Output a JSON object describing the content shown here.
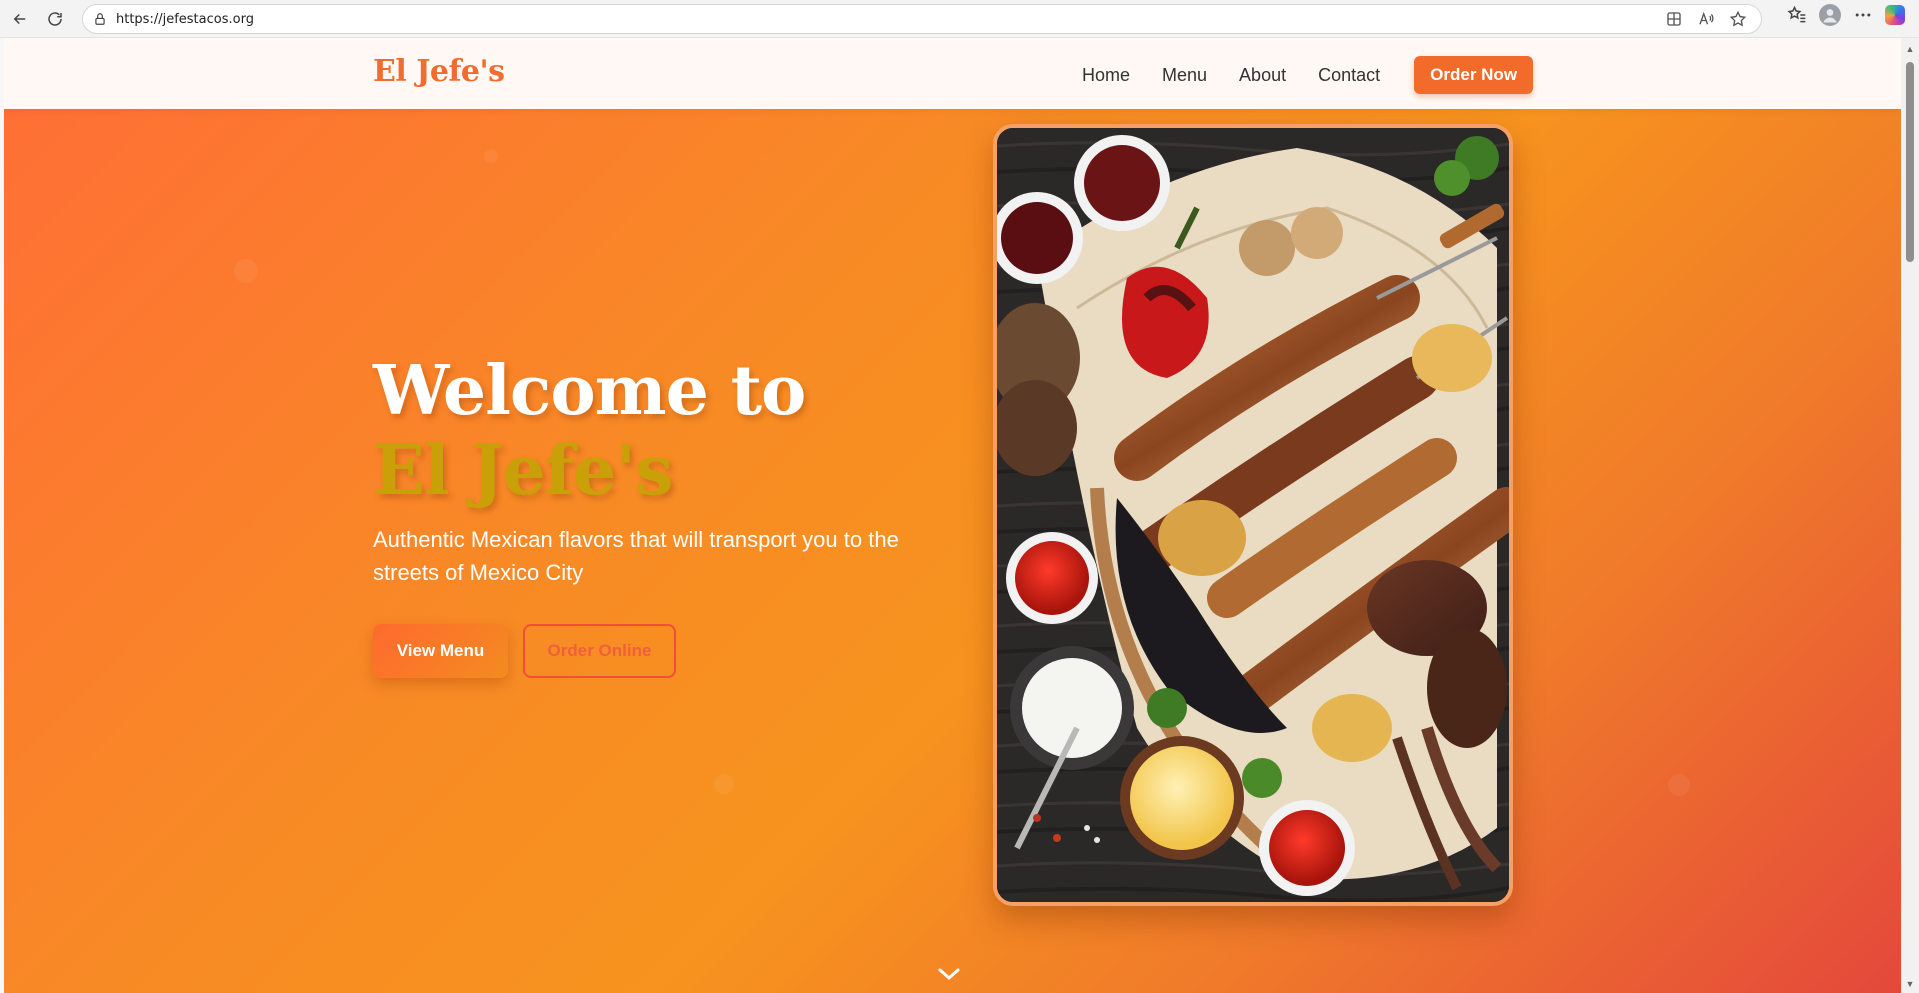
{
  "browser": {
    "url": "https://jefestacos.org"
  },
  "site": {
    "logo": "El Jefe's",
    "nav": [
      {
        "label": "Home"
      },
      {
        "label": "Menu"
      },
      {
        "label": "About"
      },
      {
        "label": "Contact"
      }
    ],
    "order_button": "Order Now"
  },
  "hero": {
    "title_prefix": "Welcome to ",
    "title_accent": "El Jefe's",
    "subtitle": "Authentic Mexican flavors that will transport you to the streets of Mexico City",
    "primary_button": "View Menu",
    "secondary_button": "Order Online",
    "image_alt": "grilled-meat-platter-icon"
  },
  "colors": {
    "brand": "#f26b2a",
    "accent_text": "#c9a008",
    "outline_button": "#f0503a"
  }
}
